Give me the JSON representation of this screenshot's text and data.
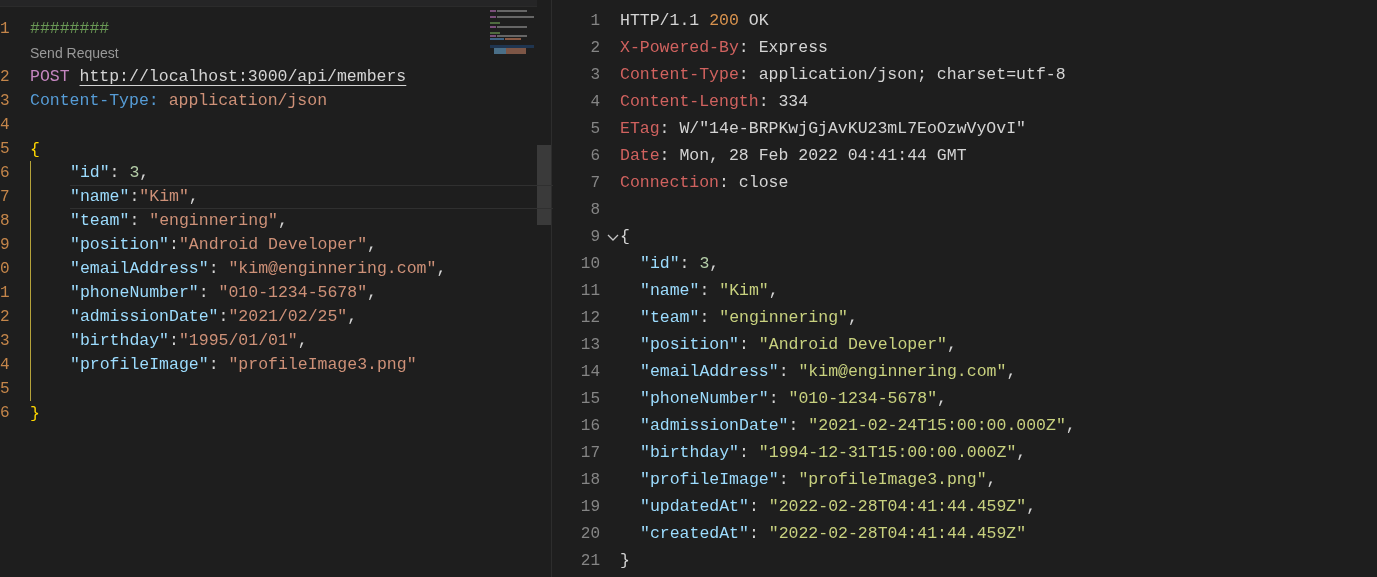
{
  "request_editor": {
    "head": [
      {
        "gutter": "1",
        "tokens": [
          {
            "t": "########",
            "kind": "comment"
          }
        ]
      },
      {
        "kind": "codelens",
        "text": "Send Request"
      },
      {
        "gutter": "2",
        "tokens": [
          {
            "t": "POST ",
            "kind": "method"
          },
          {
            "t": "http://localhost:3000/api/members",
            "kind": "url"
          }
        ]
      },
      {
        "gutter": "3",
        "tokens": [
          {
            "t": "Content-Type: ",
            "kind": "hkey"
          },
          {
            "t": "application/json",
            "kind": "hval"
          }
        ]
      },
      {
        "gutter": "4"
      }
    ],
    "open": {
      "gutter": "5",
      "text": "{"
    },
    "body": [
      {
        "gutter": "6",
        "current": false,
        "tokens": [
          {
            "t": "\"id\"",
            "kind": "key"
          },
          {
            "t": ": ",
            "kind": "punct"
          },
          {
            "t": "3",
            "kind": "number"
          },
          {
            "t": ",",
            "kind": "punct"
          }
        ]
      },
      {
        "gutter": "7",
        "current": true,
        "tokens": [
          {
            "t": "\"name\"",
            "kind": "key"
          },
          {
            "t": ":",
            "kind": "punct"
          },
          {
            "t": "\"Kim\"",
            "kind": "string"
          },
          {
            "t": ",",
            "kind": "punct"
          }
        ]
      },
      {
        "gutter": "8",
        "current": false,
        "tokens": [
          {
            "t": "\"team\"",
            "kind": "key"
          },
          {
            "t": ": ",
            "kind": "punct"
          },
          {
            "t": "\"enginnering\"",
            "kind": "string"
          },
          {
            "t": ",",
            "kind": "punct"
          }
        ]
      },
      {
        "gutter": "9",
        "current": false,
        "tokens": [
          {
            "t": "\"position\"",
            "kind": "key"
          },
          {
            "t": ":",
            "kind": "punct"
          },
          {
            "t": "\"Android Developer\"",
            "kind": "string"
          },
          {
            "t": ",",
            "kind": "punct"
          }
        ]
      },
      {
        "gutter": "0",
        "current": false,
        "tokens": [
          {
            "t": "\"emailAddress\"",
            "kind": "key"
          },
          {
            "t": ": ",
            "kind": "punct"
          },
          {
            "t": "\"kim@enginnering.com\"",
            "kind": "string"
          },
          {
            "t": ",",
            "kind": "punct"
          }
        ]
      },
      {
        "gutter": "1",
        "current": false,
        "tokens": [
          {
            "t": "\"phoneNumber\"",
            "kind": "key"
          },
          {
            "t": ": ",
            "kind": "punct"
          },
          {
            "t": "\"010-1234-5678\"",
            "kind": "string"
          },
          {
            "t": ",",
            "kind": "punct"
          }
        ]
      },
      {
        "gutter": "2",
        "current": false,
        "tokens": [
          {
            "t": "\"admissionDate\"",
            "kind": "key"
          },
          {
            "t": ":",
            "kind": "punct"
          },
          {
            "t": "\"2021/02/25\"",
            "kind": "string"
          },
          {
            "t": ",",
            "kind": "punct"
          }
        ]
      },
      {
        "gutter": "3",
        "current": false,
        "tokens": [
          {
            "t": "\"birthday\"",
            "kind": "key"
          },
          {
            "t": ":",
            "kind": "punct"
          },
          {
            "t": "\"1995/01/01\"",
            "kind": "string"
          },
          {
            "t": ",",
            "kind": "punct"
          }
        ]
      },
      {
        "gutter": "4",
        "current": false,
        "tokens": [
          {
            "t": "\"profileImage\"",
            "kind": "key"
          },
          {
            "t": ": ",
            "kind": "punct"
          },
          {
            "t": "\"profileImage3.png\"",
            "kind": "string"
          }
        ]
      },
      {
        "gutter": "5",
        "current": false
      }
    ],
    "close": {
      "gutter": "6",
      "text": "}"
    }
  },
  "response_viewer": {
    "head": [
      {
        "number": "1",
        "tokens": [
          {
            "t": "HTTP/1.1 ",
            "kind": "plain"
          },
          {
            "t": "200",
            "kind": "status"
          },
          {
            "t": " OK",
            "kind": "plain"
          }
        ]
      },
      {
        "number": "2",
        "tokens": [
          {
            "t": "X-Powered-By",
            "kind": "hname"
          },
          {
            "t": ": Express",
            "kind": "plain"
          }
        ]
      },
      {
        "number": "3",
        "tokens": [
          {
            "t": "Content-Type",
            "kind": "hname"
          },
          {
            "t": ": application/json; charset=utf-8",
            "kind": "plain"
          }
        ]
      },
      {
        "number": "4",
        "tokens": [
          {
            "t": "Content-Length",
            "kind": "hname"
          },
          {
            "t": ": 334",
            "kind": "plain"
          }
        ]
      },
      {
        "number": "5",
        "tokens": [
          {
            "t": "ETag",
            "kind": "hname"
          },
          {
            "t": ": W/\"14e-BRPKwjGjAvKU23mL7EoOzwVyOvI\"",
            "kind": "plain"
          }
        ]
      },
      {
        "number": "6",
        "tokens": [
          {
            "t": "Date",
            "kind": "hname"
          },
          {
            "t": ": Mon, 28 Feb 2022 04:41:44 GMT",
            "kind": "plain"
          }
        ]
      },
      {
        "number": "7",
        "tokens": [
          {
            "t": "Connection",
            "kind": "hname"
          },
          {
            "t": ": close",
            "kind": "plain"
          }
        ]
      },
      {
        "number": "8"
      }
    ],
    "open": {
      "number": "9",
      "text": "{",
      "expanded": true
    },
    "body": [
      {
        "number": "10",
        "tokens": [
          {
            "t": "\"id\"",
            "kind": "key"
          },
          {
            "t": ": ",
            "kind": "punct"
          },
          {
            "t": "3",
            "kind": "number"
          },
          {
            "t": ",",
            "kind": "punct"
          }
        ]
      },
      {
        "number": "11",
        "tokens": [
          {
            "t": "\"name\"",
            "kind": "key"
          },
          {
            "t": ": ",
            "kind": "punct"
          },
          {
            "t": "\"Kim\"",
            "kind": "rstring"
          },
          {
            "t": ",",
            "kind": "punct"
          }
        ]
      },
      {
        "number": "12",
        "tokens": [
          {
            "t": "\"team\"",
            "kind": "key"
          },
          {
            "t": ": ",
            "kind": "punct"
          },
          {
            "t": "\"enginnering\"",
            "kind": "rstring"
          },
          {
            "t": ",",
            "kind": "punct"
          }
        ]
      },
      {
        "number": "13",
        "tokens": [
          {
            "t": "\"position\"",
            "kind": "key"
          },
          {
            "t": ": ",
            "kind": "punct"
          },
          {
            "t": "\"Android Developer\"",
            "kind": "rstring"
          },
          {
            "t": ",",
            "kind": "punct"
          }
        ]
      },
      {
        "number": "14",
        "tokens": [
          {
            "t": "\"emailAddress\"",
            "kind": "key"
          },
          {
            "t": ": ",
            "kind": "punct"
          },
          {
            "t": "\"kim@enginnering.com\"",
            "kind": "rstring"
          },
          {
            "t": ",",
            "kind": "punct"
          }
        ]
      },
      {
        "number": "15",
        "tokens": [
          {
            "t": "\"phoneNumber\"",
            "kind": "key"
          },
          {
            "t": ": ",
            "kind": "punct"
          },
          {
            "t": "\"010-1234-5678\"",
            "kind": "rstring"
          },
          {
            "t": ",",
            "kind": "punct"
          }
        ]
      },
      {
        "number": "16",
        "tokens": [
          {
            "t": "\"admissionDate\"",
            "kind": "key"
          },
          {
            "t": ": ",
            "kind": "punct"
          },
          {
            "t": "\"2021-02-24T15:00:00.000Z\"",
            "kind": "rstring"
          },
          {
            "t": ",",
            "kind": "punct"
          }
        ]
      },
      {
        "number": "17",
        "tokens": [
          {
            "t": "\"birthday\"",
            "kind": "key"
          },
          {
            "t": ": ",
            "kind": "punct"
          },
          {
            "t": "\"1994-12-31T15:00:00.000Z\"",
            "kind": "rstring"
          },
          {
            "t": ",",
            "kind": "punct"
          }
        ]
      },
      {
        "number": "18",
        "tokens": [
          {
            "t": "\"profileImage\"",
            "kind": "key"
          },
          {
            "t": ": ",
            "kind": "punct"
          },
          {
            "t": "\"profileImage3.png\"",
            "kind": "rstring"
          },
          {
            "t": ",",
            "kind": "punct"
          }
        ]
      },
      {
        "number": "19",
        "tokens": [
          {
            "t": "\"updatedAt\"",
            "kind": "key"
          },
          {
            "t": ": ",
            "kind": "punct"
          },
          {
            "t": "\"2022-02-28T04:41:44.459Z\"",
            "kind": "rstring"
          },
          {
            "t": ",",
            "kind": "punct"
          }
        ]
      },
      {
        "number": "20",
        "tokens": [
          {
            "t": "\"createdAt\"",
            "kind": "key"
          },
          {
            "t": ": ",
            "kind": "punct"
          },
          {
            "t": "\"2022-02-28T04:41:44.459Z\"",
            "kind": "rstring"
          }
        ]
      }
    ],
    "close": {
      "number": "21",
      "text": "}"
    }
  }
}
